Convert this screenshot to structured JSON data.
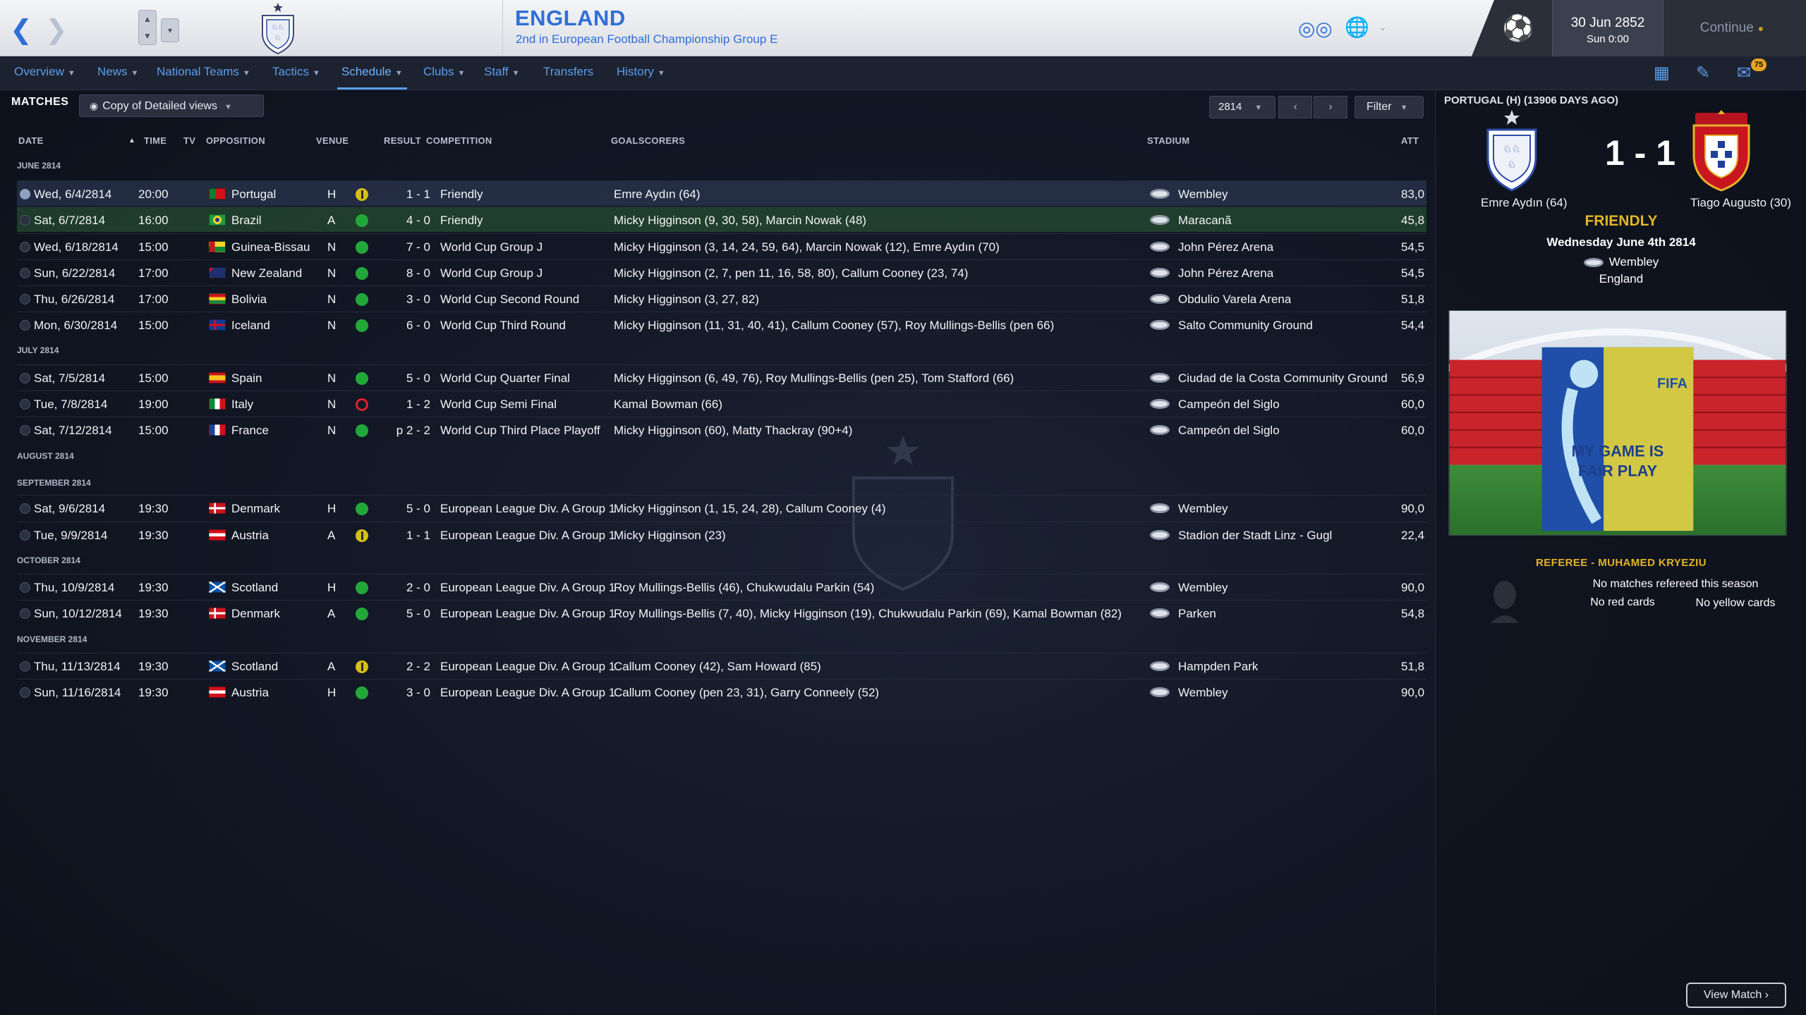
{
  "header": {
    "team_name": "ENGLAND",
    "team_subtitle": "2nd in European Football Championship Group E",
    "date_main": "30 Jun 2852",
    "date_sub": "Sun 0:00",
    "continue_label": "Continue",
    "inbox_count": "75",
    "icons": [
      "back-arrow-icon",
      "forward-arrow-icon",
      "binoculars-icon",
      "globe-icon",
      "football-icon",
      "tactics-board-icon",
      "edit-icon",
      "inbox-icon"
    ]
  },
  "nav": {
    "overview": "Overview",
    "news": "News",
    "national_teams": "National Teams",
    "tactics": "Tactics",
    "schedule": "Schedule",
    "clubs": "Clubs",
    "staff": "Staff",
    "transfers": "Transfers",
    "history": "History"
  },
  "matches": {
    "title": "MATCHES",
    "view_name": "Copy of Detailed views",
    "year": "2814",
    "filter_label": "Filter",
    "columns": {
      "date": "DATE",
      "time": "TIME",
      "tv": "TV",
      "opposition": "OPPOSITION",
      "venue": "VENUE",
      "result": "RESULT",
      "competition": "COMPETITION",
      "goalscorers": "GOALSCORERS",
      "stadium": "STADIUM",
      "att": "ATT"
    },
    "months": {
      "june": "JUNE 2814",
      "july": "JULY 2814",
      "august": "AUGUST 2814",
      "september": "SEPTEMBER 2814",
      "october": "OCTOBER 2814",
      "november": "NOVEMBER 2814"
    },
    "rows": [
      {
        "date": "Wed, 6/4/2814",
        "time": "20:00",
        "opp": "Portugal",
        "venue": "H",
        "result": "1 - 1",
        "outcome": "draw",
        "comp": "Friendly",
        "scorers": "Emre Aydın (64)",
        "stadium": "Wembley",
        "att": "83,0"
      },
      {
        "date": "Sat, 6/7/2814",
        "time": "16:00",
        "opp": "Brazil",
        "venue": "A",
        "result": "4 - 0",
        "outcome": "win",
        "comp": "Friendly",
        "scorers": "Micky Higginson (9, 30, 58), Marcin Nowak (48)",
        "stadium": "Maracanã",
        "att": "45,8"
      },
      {
        "date": "Wed, 6/18/2814",
        "time": "15:00",
        "opp": "Guinea-Bissau",
        "venue": "N",
        "result": "7 - 0",
        "outcome": "win",
        "comp": "World Cup Group J",
        "scorers": "Micky Higginson (3, 14, 24, 59, 64), Marcin Nowak (12), Emre Aydın (70)",
        "stadium": "John Pérez Arena",
        "att": "54,5"
      },
      {
        "date": "Sun, 6/22/2814",
        "time": "17:00",
        "opp": "New Zealand",
        "venue": "N",
        "result": "8 - 0",
        "outcome": "win",
        "comp": "World Cup Group J",
        "scorers": "Micky Higginson (2, 7, pen 11, 16, 58, 80), Callum Cooney (23, 74)",
        "stadium": "John Pérez Arena",
        "att": "54,5"
      },
      {
        "date": "Thu, 6/26/2814",
        "time": "17:00",
        "opp": "Bolivia",
        "venue": "N",
        "result": "3 - 0",
        "outcome": "win",
        "comp": "World Cup Second Round",
        "scorers": "Micky Higginson (3, 27, 82)",
        "stadium": "Obdulio Varela Arena",
        "att": "51,8"
      },
      {
        "date": "Mon, 6/30/2814",
        "time": "15:00",
        "opp": "Iceland",
        "venue": "N",
        "result": "6 - 0",
        "outcome": "win",
        "comp": "World Cup Third Round",
        "scorers": "Micky Higginson (11, 31, 40, 41), Callum Cooney (57), Roy Mullings-Bellis (pen 66)",
        "stadium": "Salto Community Ground",
        "att": "54,4"
      },
      {
        "date": "Sat, 7/5/2814",
        "time": "15:00",
        "opp": "Spain",
        "venue": "N",
        "result": "5 - 0",
        "outcome": "win",
        "comp": "World Cup Quarter Final",
        "scorers": "Micky Higginson (6, 49, 76), Roy Mullings-Bellis (pen 25), Tom Stafford (66)",
        "stadium": "Ciudad de la Costa Community Ground",
        "att": "56,9"
      },
      {
        "date": "Tue, 7/8/2814",
        "time": "19:00",
        "opp": "Italy",
        "venue": "N",
        "result": "1 - 2",
        "outcome": "loss",
        "comp": "World Cup Semi Final",
        "scorers": "Kamal Bowman (66)",
        "stadium": "Campeón del Siglo",
        "att": "60,0"
      },
      {
        "date": "Sat, 7/12/2814",
        "time": "15:00",
        "opp": "France",
        "venue": "N",
        "result": "p 2 - 2",
        "outcome": "win",
        "comp": "World Cup Third Place Playoff",
        "scorers": "Micky Higginson (60), Matty Thackray (90+4)",
        "stadium": "Campeón del Siglo",
        "att": "60,0"
      },
      {
        "date": "Sat, 9/6/2814",
        "time": "19:30",
        "opp": "Denmark",
        "venue": "H",
        "result": "5 - 0",
        "outcome": "win",
        "comp": "European League Div. A Group 1",
        "scorers": "Micky Higginson (1, 15, 24, 28), Callum Cooney (4)",
        "stadium": "Wembley",
        "att": "90,0"
      },
      {
        "date": "Tue, 9/9/2814",
        "time": "19:30",
        "opp": "Austria",
        "venue": "A",
        "result": "1 - 1",
        "outcome": "draw",
        "comp": "European League Div. A Group 1",
        "scorers": "Micky Higginson (23)",
        "stadium": "Stadion der Stadt Linz - Gugl",
        "att": "22,4"
      },
      {
        "date": "Thu, 10/9/2814",
        "time": "19:30",
        "opp": "Scotland",
        "venue": "H",
        "result": "2 - 0",
        "outcome": "win",
        "comp": "European League Div. A Group 1",
        "scorers": "Roy Mullings-Bellis (46), Chukwudalu Parkin (54)",
        "stadium": "Wembley",
        "att": "90,0"
      },
      {
        "date": "Sun, 10/12/2814",
        "time": "19:30",
        "opp": "Denmark",
        "venue": "A",
        "result": "5 - 0",
        "outcome": "win",
        "comp": "European League Div. A Group 1",
        "scorers": "Roy Mullings-Bellis (7, 40), Micky Higginson (19), Chukwudalu Parkin (69), Kamal Bowman (82)",
        "stadium": "Parken",
        "att": "54,8"
      },
      {
        "date": "Thu, 11/13/2814",
        "time": "19:30",
        "opp": "Scotland",
        "venue": "A",
        "result": "2 - 2",
        "outcome": "draw",
        "comp": "European League Div. A Group 1",
        "scorers": "Callum Cooney (42), Sam Howard (85)",
        "stadium": "Hampden Park",
        "att": "51,8"
      },
      {
        "date": "Sun, 11/16/2814",
        "time": "19:30",
        "opp": "Austria",
        "venue": "H",
        "result": "3 - 0",
        "outcome": "win",
        "comp": "European League Div. A Group 1",
        "scorers": "Callum Cooney (pen 23, 31), Garry Conneely (52)",
        "stadium": "Wembley",
        "att": "90,0"
      }
    ]
  },
  "detail": {
    "heading": "PORTUGAL (H) (13906 DAYS AGO)",
    "score": "1 - 1",
    "home_scorer": "Emre Aydın (64)",
    "away_scorer": "Tiago Augusto (30)",
    "competition": "FRIENDLY",
    "date": "Wednesday June 4th 2814",
    "venue": "Wembley",
    "country": "England",
    "banner_brand": "FIFA",
    "banner_line1": "MY GAME IS",
    "banner_line2": "FAIR PLAY",
    "referee_title": "REFEREE - MUHAMED KRYEZIU",
    "referee_matches": "No matches refereed this season",
    "referee_red": "No red cards",
    "referee_yellow": "No yellow cards",
    "view_match": "View Match ›"
  },
  "colors": {
    "accent_blue": "#2f6fd6",
    "link_blue": "#5b9de8",
    "win": "#22a83a",
    "draw": "#d6bf16",
    "loss": "#e0212b",
    "gold": "#e0b526"
  }
}
